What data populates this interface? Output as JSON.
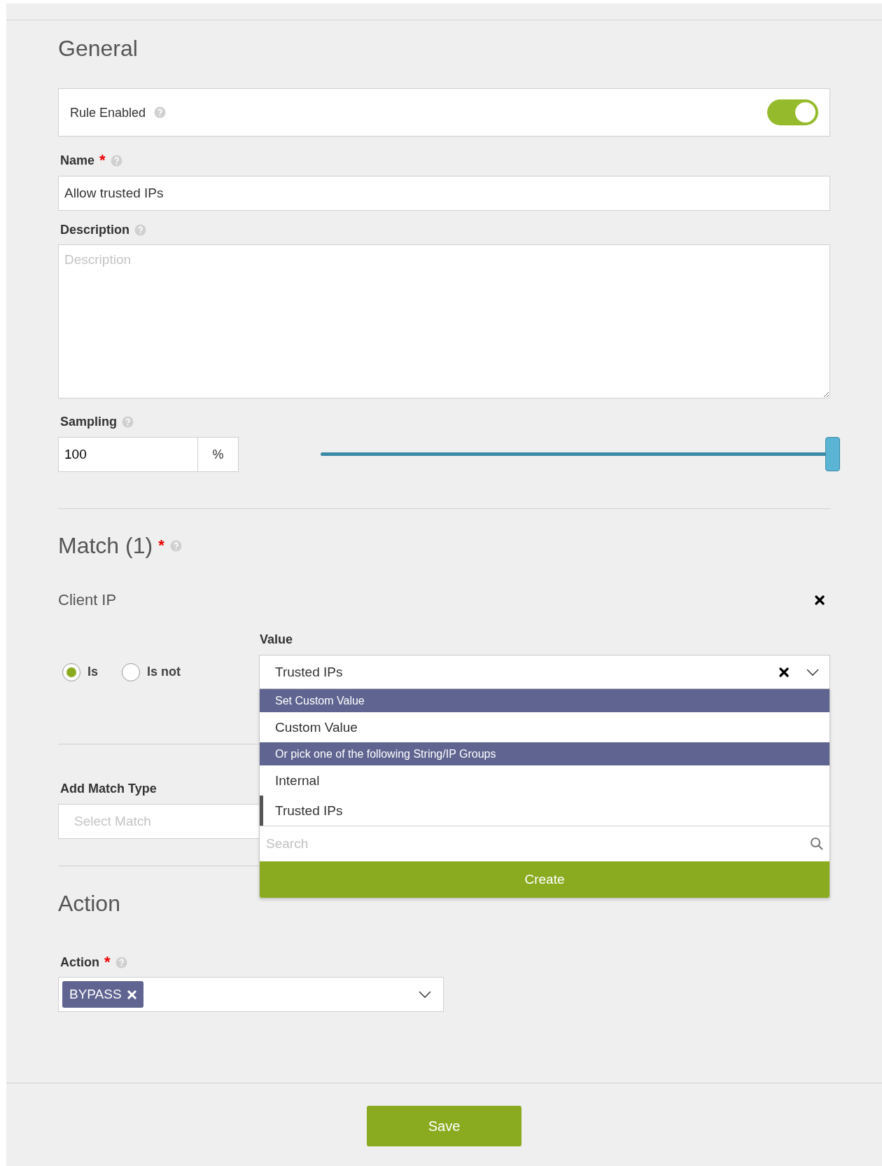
{
  "general": {
    "title": "General",
    "rule_enabled": {
      "label": "Rule Enabled",
      "on": true
    },
    "name": {
      "label": "Name",
      "required_mark": "*",
      "value": "Allow trusted IPs"
    },
    "description": {
      "label": "Description",
      "placeholder": "Description"
    },
    "sampling": {
      "label": "Sampling",
      "value": "100",
      "unit": "%",
      "level": 1
    }
  },
  "match": {
    "title": "Match (1)",
    "required_mark": "*",
    "condition": {
      "field": "Client IP",
      "operators": [
        {
          "label": "Is",
          "selected": true
        },
        {
          "label": "Is not",
          "selected": false
        }
      ],
      "value_label": "Value",
      "value": "Trusted IPs",
      "dropdown": {
        "items": [
          {
            "kind": "header",
            "label": "Set Custom Value"
          },
          {
            "kind": "option",
            "label": "Custom Value",
            "selected": false
          },
          {
            "kind": "header",
            "label": "Or pick one of the following String/IP Groups"
          },
          {
            "kind": "option",
            "label": "Internal",
            "selected": false
          },
          {
            "kind": "option",
            "label": "Trusted IPs",
            "selected": true
          }
        ],
        "search_placeholder": "Search",
        "create_button": "Create"
      }
    },
    "add_match_type": {
      "label": "Add Match Type",
      "placeholder": "Select Match"
    }
  },
  "action": {
    "title": "Action",
    "label": "Action",
    "required_mark": "*",
    "tags": [
      "BYPASS"
    ]
  },
  "footer": {
    "save_button": "Save"
  }
}
